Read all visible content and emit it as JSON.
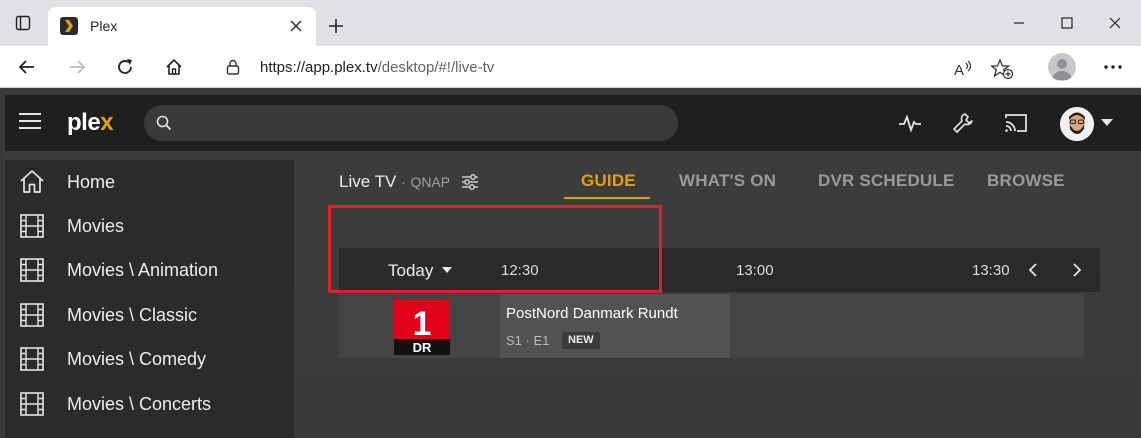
{
  "browser": {
    "tab_title": "Plex",
    "url_host": "https://app.plex.tv",
    "url_path": "/desktop/#!/live-tv"
  },
  "app": {
    "logo_text": "ple",
    "logo_x": "x",
    "search_placeholder": "",
    "sidebar": {
      "items": [
        {
          "label": "Home",
          "icon": "home-icon"
        },
        {
          "label": "Movies",
          "icon": "film-icon"
        },
        {
          "label": "Movies \\ Animation",
          "icon": "film-icon"
        },
        {
          "label": "Movies \\ Classic",
          "icon": "film-icon"
        },
        {
          "label": "Movies \\ Comedy",
          "icon": "film-icon"
        },
        {
          "label": "Movies \\ Concerts",
          "icon": "film-icon"
        }
      ]
    },
    "header": {
      "section": "Live TV",
      "separator": "·",
      "source": "QNAP"
    },
    "tabs": [
      {
        "label": "GUIDE",
        "active": true
      },
      {
        "label": "WHAT'S ON",
        "active": false
      },
      {
        "label": "DVR SCHEDULE",
        "active": false
      },
      {
        "label": "BROWSE",
        "active": false
      }
    ],
    "guide": {
      "day": "Today",
      "times": [
        "12:30",
        "13:00",
        "13:30"
      ],
      "channel": {
        "logo_number": "1",
        "logo_text": "DR",
        "program": {
          "title": "PostNord Danmark Rundt",
          "episode": "S1 · E1",
          "badge": "NEW"
        }
      }
    },
    "colors": {
      "accent": "#e5a00d",
      "highlight": "#e3202a",
      "dr_red": "#e3001b"
    }
  }
}
